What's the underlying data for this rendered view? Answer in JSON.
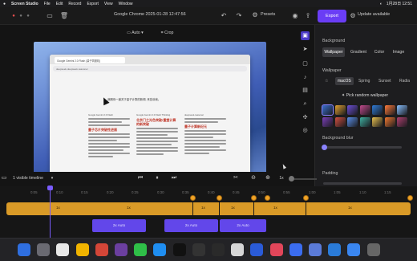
{
  "menubar": {
    "app_name": "Screen Studio",
    "items": [
      "File",
      "Edit",
      "Record",
      "Export",
      "View",
      "Window"
    ],
    "clock": "1月28日 12:51"
  },
  "toolbar": {
    "document_title": "Google Chrome 2025-01-28 12:47:56",
    "presets_label": "Presets",
    "export_label": "Export",
    "update_label": "Update available"
  },
  "canvas": {
    "aspect_label": "Auto",
    "crop_label": "Crop"
  },
  "browser": {
    "tab_text": "Google Gemini 2.0 Flash (量子简报机)",
    "url_text": "deepseek.deepseek-reasoner",
    "heading_text": "我期待一道关于量子计算的新闻, 来告诉我。",
    "col1_header": "Google Gemini 2.0 Flash",
    "col2_header": "Google Gemini 2.0 Flash Thinking",
    "col3_header": "deepseek-reasoner",
    "col1_red": "量子芯片突破性进展",
    "col2_red": "北京门之光色突破!重塑计算的新突破",
    "col3_red": "量子计算新纪元",
    "bottom_text": "问我任何问题..."
  },
  "panel": {
    "background_label": "Background",
    "bg_tabs": [
      "Wallpaper",
      "Gradient",
      "Color",
      "Image"
    ],
    "wallpaper_label": "Wallpaper",
    "wp_tabs": [
      "macOS",
      "Spring",
      "Sunset",
      "Radia"
    ],
    "random_label": "Pick random wallpaper",
    "blur_label": "Background blur",
    "blur_value": 0.02,
    "padding_label": "Padding",
    "swatch_colors": [
      "#3a6fd0",
      "#e0a030",
      "#6b4fd6",
      "#c04a8c",
      "#2f7bd6",
      "#ff7a3a",
      "#88c0ff",
      "#7a3fb8",
      "#d05040",
      "#5a8fe8",
      "#3fb0a0",
      "#e8c050",
      "#f07830",
      "#b04070"
    ]
  },
  "timeline_controls": {
    "visible_timeline_label": "1 visible timeline",
    "speed_label": "1x"
  },
  "timeline": {
    "ruler_ticks": [
      "0:05",
      "0:10",
      "0:15",
      "0:20",
      "0:25",
      "0:30",
      "0:35",
      "0:40",
      "0:45",
      "0:50",
      "0:55",
      "1:00",
      "1:05",
      "1:10",
      "1:15"
    ],
    "clip_labels": [
      "1x",
      "1x",
      "1x",
      "1x",
      "1x",
      "1x"
    ],
    "zoom_clips": [
      "2x  Auto",
      "2x  Auto",
      "2x  Auto"
    ]
  },
  "dock": {
    "apps": [
      "Finder",
      "Launchpad",
      "ChatGPT",
      "Chrome",
      "Gmail",
      "Obsidian",
      "WeChat",
      "Safari",
      "OpenAI",
      "Terminal",
      "Cursor",
      "Arc",
      "Clips",
      "Music",
      "Chat",
      "Grid",
      "Code",
      "Mail",
      "Trash"
    ]
  }
}
